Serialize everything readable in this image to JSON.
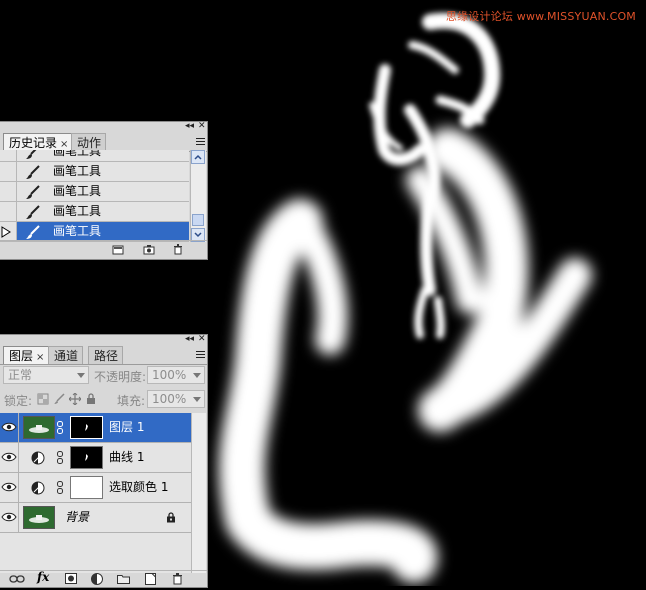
{
  "watermark": "思缘设计论坛 www.MISSYUAN.COM",
  "history_panel": {
    "tabs": [
      {
        "label": "历史记录",
        "close": "×"
      },
      {
        "label": "动作"
      }
    ],
    "items": [
      {
        "label": "画笔工具"
      },
      {
        "label": "画笔工具"
      },
      {
        "label": "画笔工具"
      },
      {
        "label": "画笔工具"
      },
      {
        "label": "画笔工具",
        "selected": true
      }
    ],
    "footer_icons": [
      "new-document-from-state-icon",
      "create-snapshot-icon",
      "trash-icon"
    ]
  },
  "layers_panel": {
    "tabs": [
      {
        "label": "图层",
        "close": "×"
      },
      {
        "label": "通道"
      },
      {
        "label": "路径"
      }
    ],
    "blend_mode": "正常",
    "opacity_label": "不透明度:",
    "opacity_value": "100%",
    "lock_label": "锁定:",
    "fill_label": "填充:",
    "fill_value": "100%",
    "layers": [
      {
        "name": "图层 1",
        "selected": true,
        "thumbnail": "photo",
        "mask": "black"
      },
      {
        "name": "曲线 1",
        "thumbnail": "curves-adjustment-icon",
        "mask": "black"
      },
      {
        "name": "选取颜色 1",
        "thumbnail": "selective-color-adjustment-icon",
        "mask": "white"
      },
      {
        "name": "背景",
        "thumbnail": "photo",
        "locked": true
      }
    ],
    "footer_icons": [
      "link-icon",
      "fx-icon",
      "add-mask-icon",
      "adjustment-layer-icon",
      "group-folder-icon",
      "new-layer-icon",
      "trash-icon"
    ],
    "fx_label": "fx"
  },
  "colors": {
    "selection": "#316ac5",
    "panel_bg": "#d8d8d8",
    "canvas_bg": "#000000",
    "watermark": "#e0522a"
  }
}
